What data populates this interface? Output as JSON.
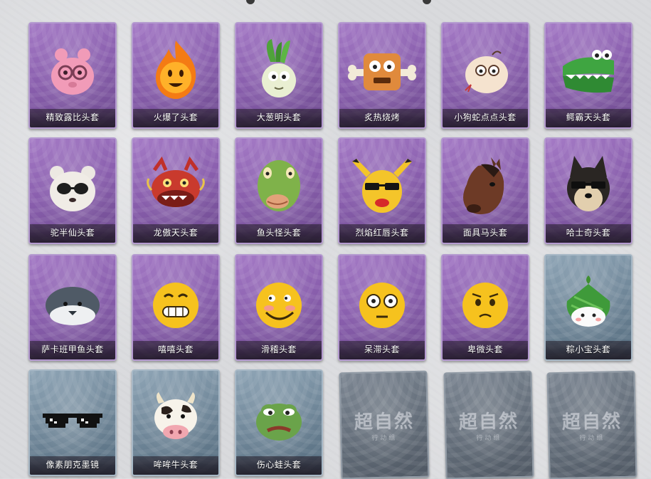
{
  "items": [
    {
      "label": "精致露比头套",
      "icon": "pink-piggy-head-icon",
      "rarity": "purple"
    },
    {
      "label": "火爆了头套",
      "icon": "fireball-head-icon",
      "rarity": "purple"
    },
    {
      "label": "大葱明头套",
      "icon": "scallion-head-icon",
      "rarity": "purple"
    },
    {
      "label": "炙热烧烤",
      "icon": "toast-bone-head-icon",
      "rarity": "purple"
    },
    {
      "label": "小狗蛇点点头套",
      "icon": "snake-puppy-head-icon",
      "rarity": "purple"
    },
    {
      "label": "鳄霸天头套",
      "icon": "crocodile-head-icon",
      "rarity": "purple"
    },
    {
      "label": "驼半仙头套",
      "icon": "sunglasses-bear-head-icon",
      "rarity": "purple"
    },
    {
      "label": "龙傲天头套",
      "icon": "dragon-head-icon",
      "rarity": "purple"
    },
    {
      "label": "鱼头怪头套",
      "icon": "fish-monster-head-icon",
      "rarity": "purple"
    },
    {
      "label": "烈焰红唇头套",
      "icon": "pikachu-lips-head-icon",
      "rarity": "purple"
    },
    {
      "label": "面具马头套",
      "icon": "horse-mask-head-icon",
      "rarity": "purple"
    },
    {
      "label": "哈士奇头套",
      "icon": "husky-head-icon",
      "rarity": "purple"
    },
    {
      "label": "萨卡班甲鱼头套",
      "icon": "sacabambaspis-head-icon",
      "rarity": "purple"
    },
    {
      "label": "嘻嘻头套",
      "icon": "grinning-emoji-head-icon",
      "rarity": "purple"
    },
    {
      "label": "滑稽头套",
      "icon": "smirk-emoji-head-icon",
      "rarity": "purple"
    },
    {
      "label": "呆滞头套",
      "icon": "stunned-emoji-head-icon",
      "rarity": "purple"
    },
    {
      "label": "卑微头套",
      "icon": "pleading-emoji-head-icon",
      "rarity": "purple"
    },
    {
      "label": "粽小宝头套",
      "icon": "zongzi-head-icon",
      "rarity": "blue"
    },
    {
      "label": "像素朋克墨镜",
      "icon": "pixel-sunglasses-icon",
      "rarity": "blue"
    },
    {
      "label": "哞哞牛头套",
      "icon": "cow-head-icon",
      "rarity": "blue"
    },
    {
      "label": "伤心蛙头套",
      "icon": "sad-frog-head-icon",
      "rarity": "blue"
    },
    {
      "label": "",
      "icon": "locked-slot-icon",
      "rarity": "locked",
      "watermark": "超自然",
      "watermark_sub": "行动组"
    },
    {
      "label": "",
      "icon": "locked-slot-icon",
      "rarity": "locked",
      "watermark": "超自然",
      "watermark_sub": "行动组"
    },
    {
      "label": "",
      "icon": "locked-slot-icon",
      "rarity": "locked",
      "watermark": "超自然",
      "watermark_sub": "行动组"
    }
  ],
  "colors": {
    "purple_card": "#8a5fae",
    "blue_card": "#6f8698",
    "locked_card": "#626c78",
    "background": "#d9dadd"
  }
}
